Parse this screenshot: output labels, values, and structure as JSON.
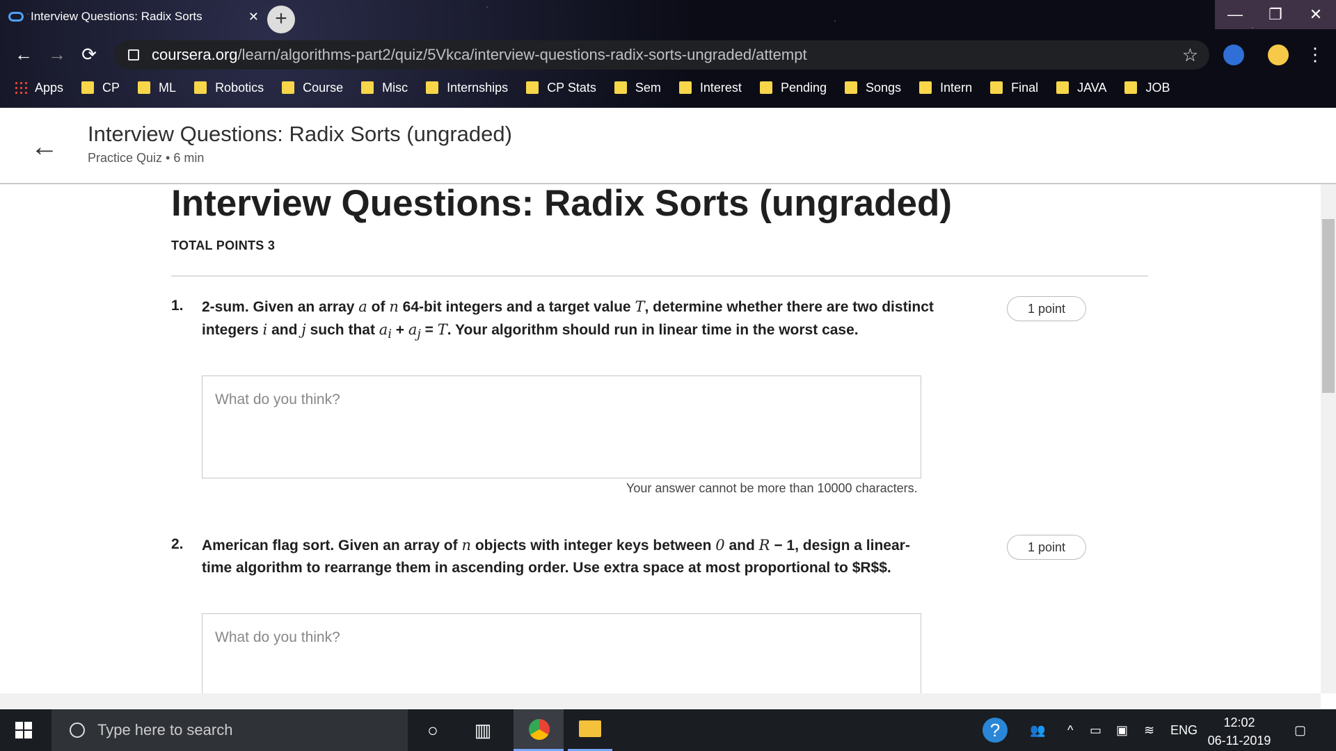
{
  "browser": {
    "tab_title": "Interview Questions: Radix Sorts",
    "tab_close": "✕",
    "new_tab": "+",
    "window_controls": [
      "—",
      "❐",
      "✕"
    ],
    "url_host": "coursera.org",
    "url_path": "/learn/algorithms-part2/quiz/5Vkca/interview-questions-radix-sorts-ungraded/attempt",
    "bookmarks": [
      "Apps",
      "CP",
      "ML",
      "Robotics",
      "Course",
      "Misc",
      "Internships",
      "CP Stats",
      "Sem",
      "Interest",
      "Pending",
      "Songs",
      "Intern",
      "Final",
      "JAVA",
      "JOB"
    ]
  },
  "header": {
    "title": "Interview Questions: Radix Sorts (ungraded)",
    "subtitle": "Practice Quiz • 6 min"
  },
  "main": {
    "heading": "Interview Questions: Radix Sorts (ungraded)",
    "total_points": "TOTAL POINTS 3",
    "questions": [
      {
        "number": "1.",
        "text_html": "2-sum. Given an array <i>a</i> of <i>n</i> 64-bit integers and a target value <i>T</i>, determine whether there are two distinct integers <i>i</i> and <i>j</i> such that <i>a<sub>i</sub></i> + <i>a<sub>j</sub></i> = <i>T</i>. Your algorithm should run in linear time in the worst case.",
        "points": "1 point",
        "placeholder": "What do you think?",
        "limit": "Your answer cannot be more than 10000 characters."
      },
      {
        "number": "2.",
        "text_html": "American flag sort. Given an array of <i>n</i> objects with integer keys between <i>0</i> and <i>R</i> − 1, design a linear-time algorithm to rearrange them in ascending order. Use extra space at most proportional to $R$$.",
        "points": "1 point",
        "placeholder": "What do you think?"
      }
    ]
  },
  "taskbar": {
    "search_placeholder": "Type here to search",
    "language": "ENG",
    "time": "12:02",
    "date": "06-11-2019"
  }
}
